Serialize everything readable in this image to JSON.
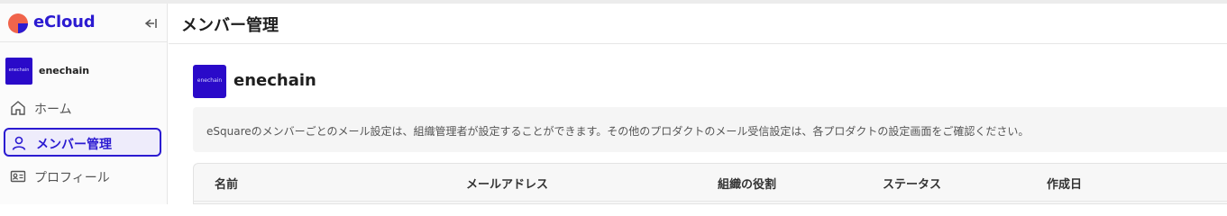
{
  "app": {
    "brand_name": "eCloud"
  },
  "sidebar": {
    "org_name": "enechain",
    "org_logo_text": "enechain",
    "items": [
      {
        "label": "ホーム",
        "icon": "home-icon"
      },
      {
        "label": "メンバー管理",
        "icon": "person-icon",
        "active": true
      },
      {
        "label": "プロフィール",
        "icon": "id-card-icon"
      }
    ]
  },
  "header": {
    "title": "メンバー管理"
  },
  "main": {
    "org_name": "enechain",
    "org_logo_text": "enechain",
    "notice": "eSquareのメンバーごとのメール設定は、組織管理者が設定することができます。その他のプロダクトのメール受信設定は、各プロダクトの設定画面をご確認ください。",
    "table": {
      "columns": [
        "名前",
        "メールアドレス",
        "組織の役割",
        "ステータス",
        "作成日"
      ]
    }
  },
  "colors": {
    "accent": "#2b1ad1",
    "brand_logo_orange": "#f0644b",
    "brand_logo_purple": "#2b1ad1",
    "active_bg": "#eeecfb"
  }
}
